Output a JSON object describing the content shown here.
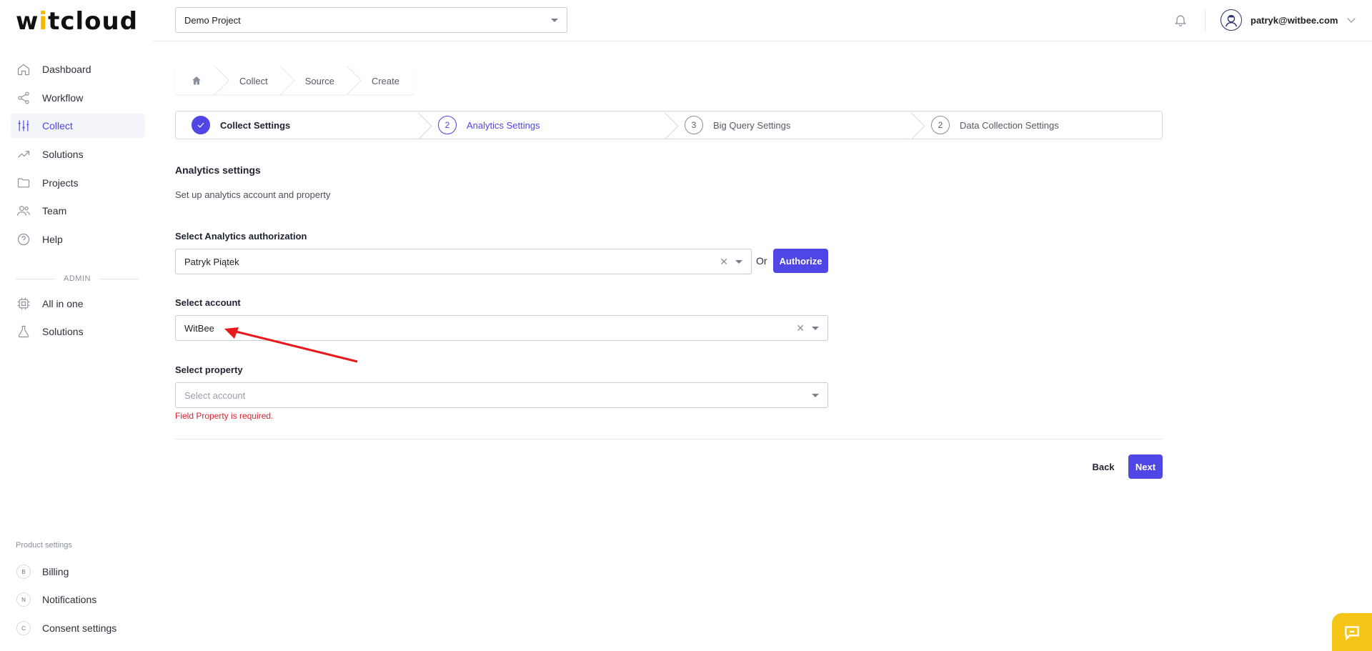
{
  "app": {
    "logo_text_a": "w",
    "logo_text_accent": "i",
    "logo_text_b": "tcloud"
  },
  "sidebar": {
    "items": [
      {
        "label": "Dashboard",
        "icon": "home-icon"
      },
      {
        "label": "Workflow",
        "icon": "share-icon"
      },
      {
        "label": "Collect",
        "icon": "sliders-icon",
        "active": true
      },
      {
        "label": "Solutions",
        "icon": "trending-up-icon"
      },
      {
        "label": "Projects",
        "icon": "folder-icon"
      },
      {
        "label": "Team",
        "icon": "users-icon"
      },
      {
        "label": "Help",
        "icon": "help-circle-icon"
      }
    ],
    "admin_label": "ADMIN",
    "admin_items": [
      {
        "label": "All in one",
        "icon": "cpu-icon"
      },
      {
        "label": "Solutions",
        "icon": "flask-icon"
      }
    ],
    "product_settings_title": "Product settings",
    "product_items": [
      {
        "label": "Billing",
        "badge": "B"
      },
      {
        "label": "Notifications",
        "badge": "N"
      },
      {
        "label": "Consent settings",
        "badge": "C"
      }
    ]
  },
  "header": {
    "project": "Demo Project",
    "user_email": "patryk@witbee.com"
  },
  "breadcrumb": [
    "Collect",
    "Source",
    "Create"
  ],
  "stepper": [
    {
      "number": "",
      "label": "Collect Settings",
      "state": "done"
    },
    {
      "number": "2",
      "label": "Analytics Settings",
      "state": "current"
    },
    {
      "number": "3",
      "label": "Big Query Settings",
      "state": "pending"
    },
    {
      "number": "2",
      "label": "Data Collection Settings",
      "state": "pending"
    }
  ],
  "form": {
    "title": "Analytics settings",
    "subtitle": "Set up analytics account and property",
    "auth_label": "Select Analytics authorization",
    "auth_value": "Patryk Piątek",
    "or_text": "Or",
    "authorize_label": "Authorize",
    "account_label": "Select account",
    "account_value": "WitBee",
    "property_label": "Select property",
    "property_placeholder": "Select account",
    "property_error": "Field Property is required.",
    "back_label": "Back",
    "next_label": "Next"
  },
  "colors": {
    "accent": "#4f46e5",
    "error": "#d9202e",
    "logo_accent": "#f5b800",
    "chat": "#f5c518",
    "annotation_arrow": "#e8191c"
  }
}
